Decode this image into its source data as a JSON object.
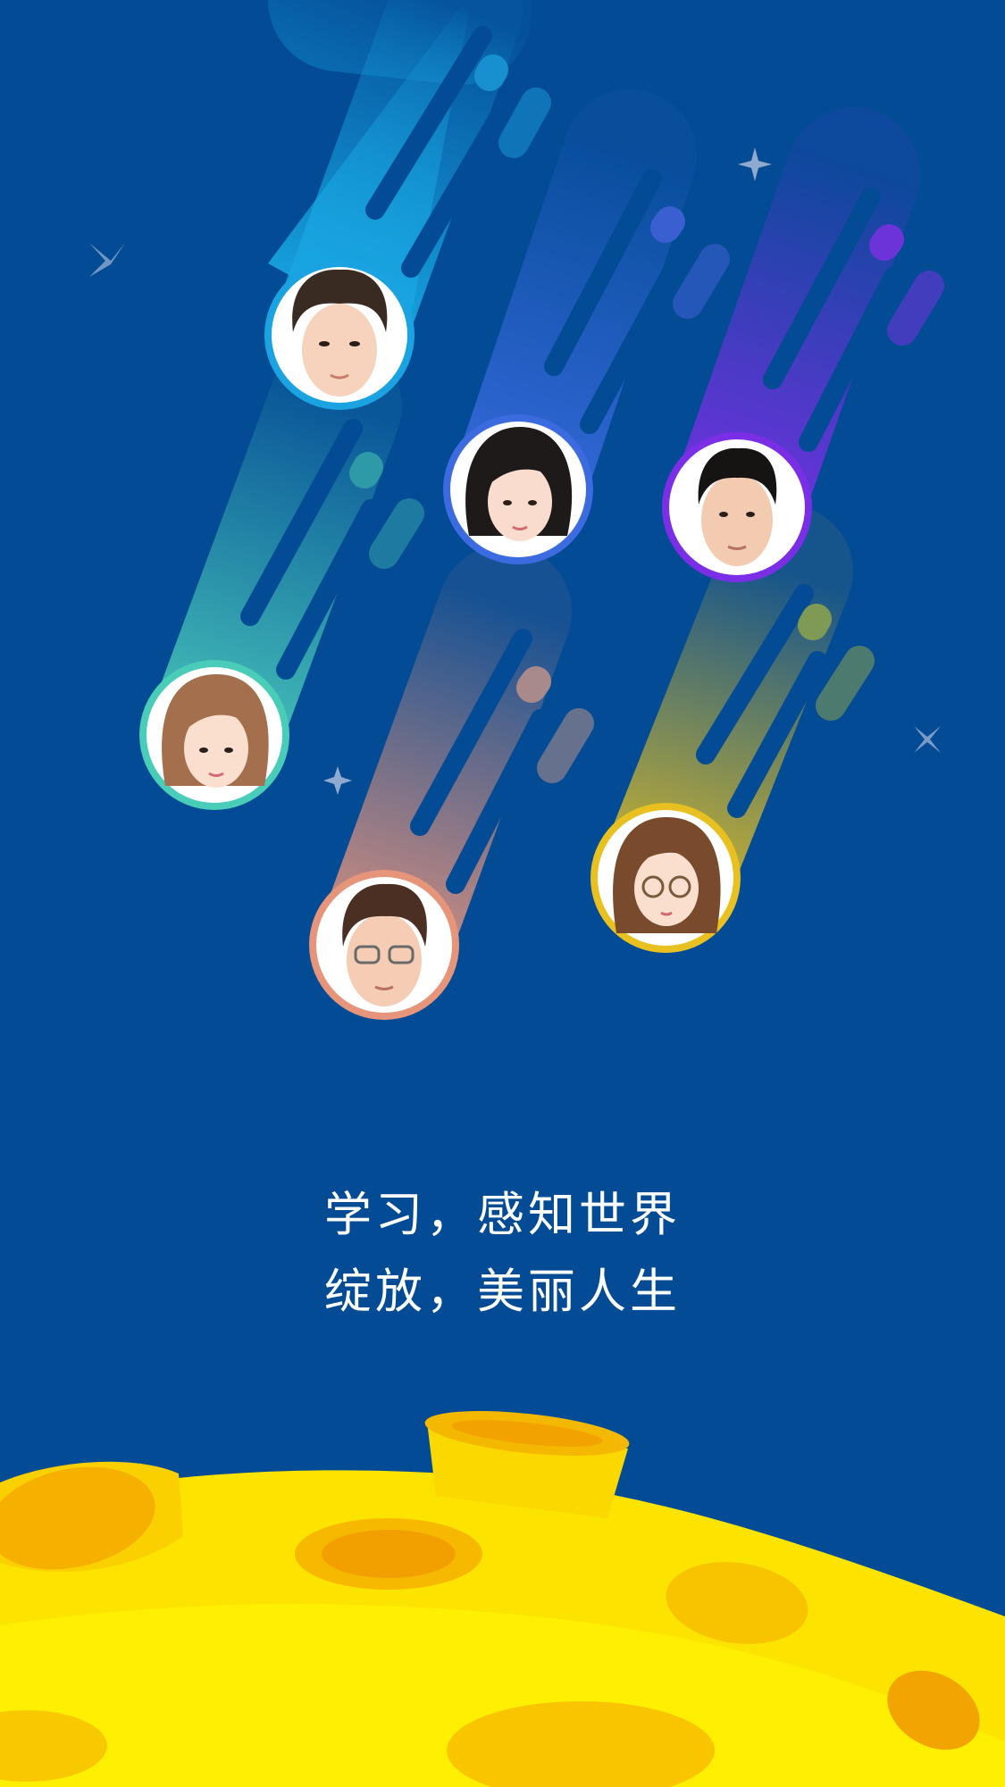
{
  "screen": {
    "name": "splash-screen",
    "background_color": "#034b95"
  },
  "tagline": {
    "line1": "学习，感知世界",
    "line2": "绽放，美丽人生"
  },
  "avatars": [
    {
      "id": "boy-spiky-hair",
      "color": "#1aa3e0"
    },
    {
      "id": "girl-black-bob",
      "color": "#3c6be0"
    },
    {
      "id": "boy-short-black-hair",
      "color": "#7a2fe6"
    },
    {
      "id": "girl-light-brown-hair",
      "color": "#49cdb9"
    },
    {
      "id": "boy-glasses",
      "color": "#e6957a"
    },
    {
      "id": "girl-glasses",
      "color": "#e8c020"
    }
  ],
  "decorations": {
    "stars": [
      "star-icon",
      "sparkle-icon"
    ],
    "planet": {
      "name": "yellow-moon",
      "color": "#ffe600",
      "crater_color": "#f5a400"
    }
  }
}
